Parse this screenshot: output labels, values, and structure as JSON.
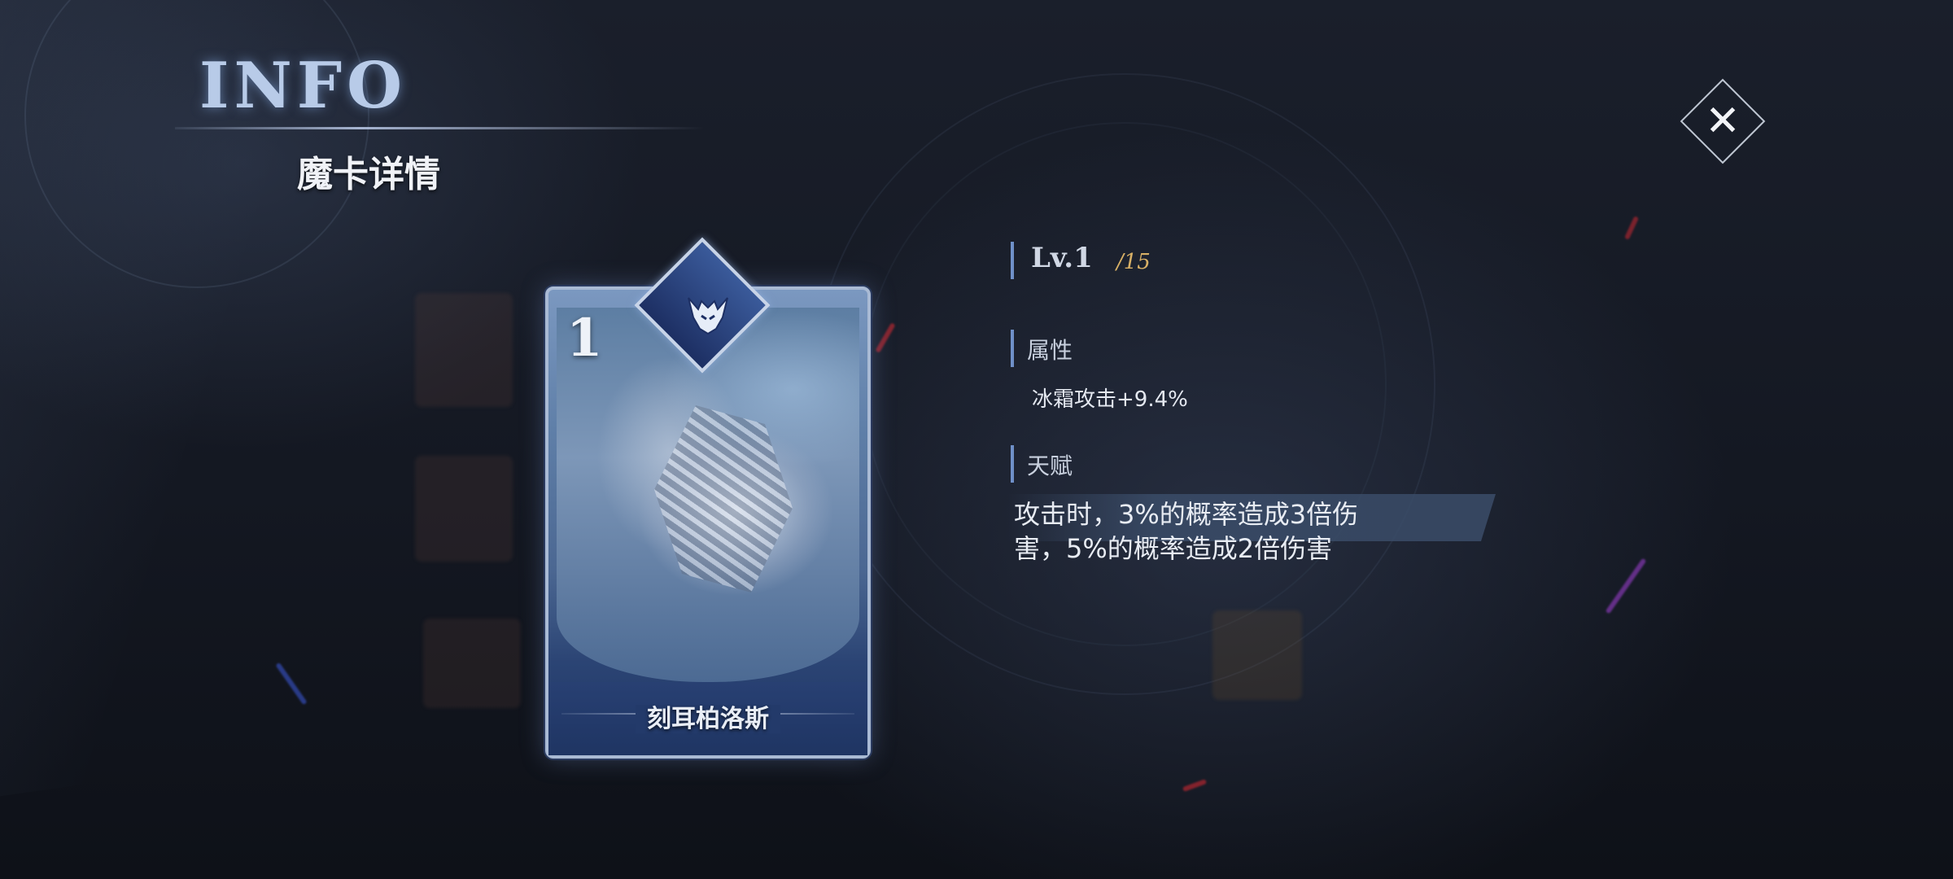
{
  "header": {
    "title": "INFO",
    "subtitle": "魔卡详情"
  },
  "close_button": {
    "icon": "close-icon",
    "label": "✕"
  },
  "card": {
    "level_badge": "1",
    "name": "刻耳柏洛斯",
    "emblem_icon": "horned-helmet-icon"
  },
  "level": {
    "current": "Lv.1",
    "max": "/15"
  },
  "attributes": {
    "label": "属性",
    "value": "冰霜攻击+9.4%"
  },
  "talent": {
    "label": "天赋",
    "description": "攻击时，3%的概率造成3倍伤害，5%的概率造成2倍伤害"
  },
  "colors": {
    "accent_bar": "#6f90c8",
    "level_max": "#d8b066",
    "card_blue": "#1f3563"
  }
}
